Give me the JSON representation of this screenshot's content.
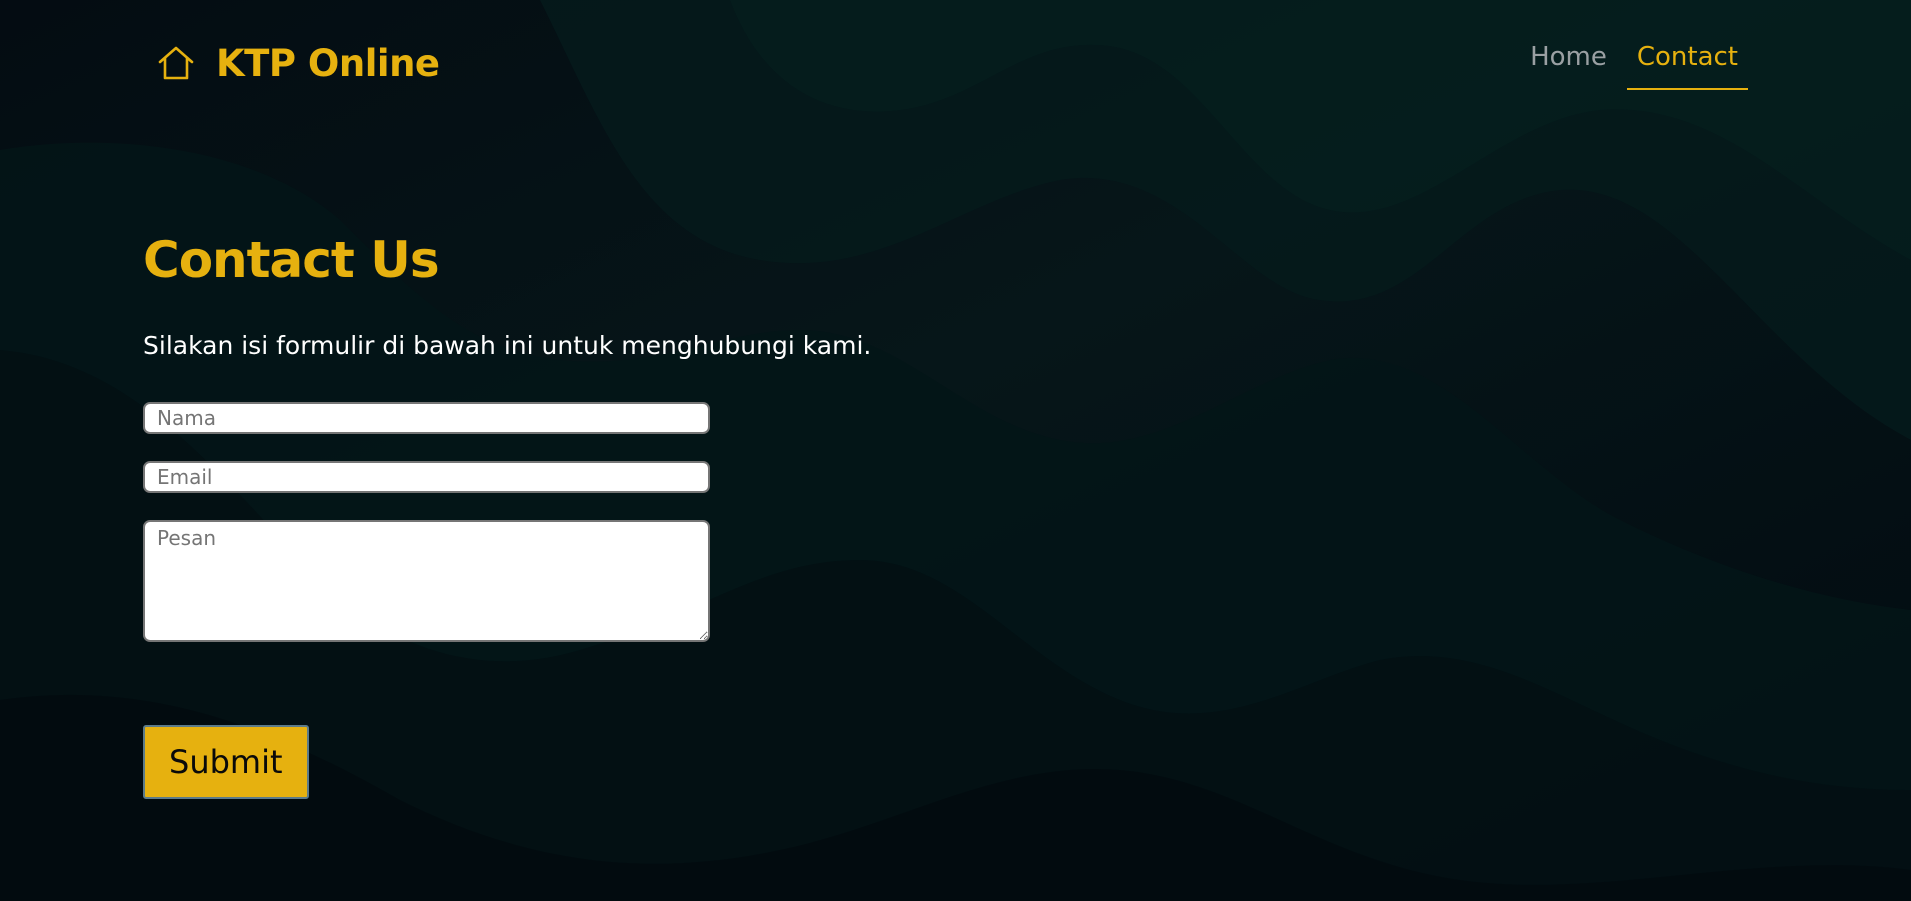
{
  "colors": {
    "accent": "#e6b10f",
    "background": "#030b10",
    "nav_inactive": "#9aa0a3",
    "text": "#ffffff"
  },
  "header": {
    "brand_icon": "home-icon",
    "brand_title": "KTP Online",
    "nav": [
      {
        "label": "Home",
        "active": false
      },
      {
        "label": "Contact",
        "active": true
      }
    ]
  },
  "main": {
    "title": "Contact Us",
    "subtitle": "Silakan isi formulir di bawah ini untuk menghubungi kami."
  },
  "form": {
    "name_placeholder": "Nama",
    "name_value": "",
    "email_placeholder": "Email",
    "email_value": "",
    "message_placeholder": "Pesan",
    "message_value": "",
    "submit_label": "Submit"
  }
}
